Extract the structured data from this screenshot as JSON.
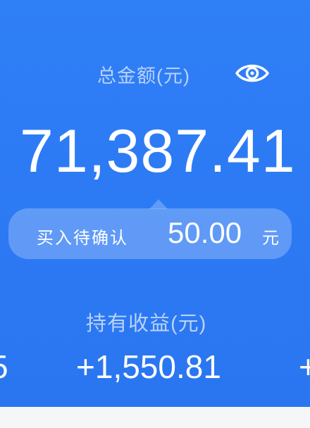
{
  "colors": {
    "panel_bg": "#2f7cf6",
    "label_text": "#b9d2fb",
    "value_text": "#ffffff",
    "bubble_bg": "#7aaaf6"
  },
  "total": {
    "label": "总金额(元)",
    "value": "71,387.41",
    "visibility_icon": "eye-icon"
  },
  "pending": {
    "label": "买入待确认",
    "amount": "50.00",
    "unit": "元"
  },
  "profit": {
    "label": "持有收益(元)",
    "value": "+1,550.81",
    "left_edge_text": "5",
    "right_edge_text": "+"
  }
}
